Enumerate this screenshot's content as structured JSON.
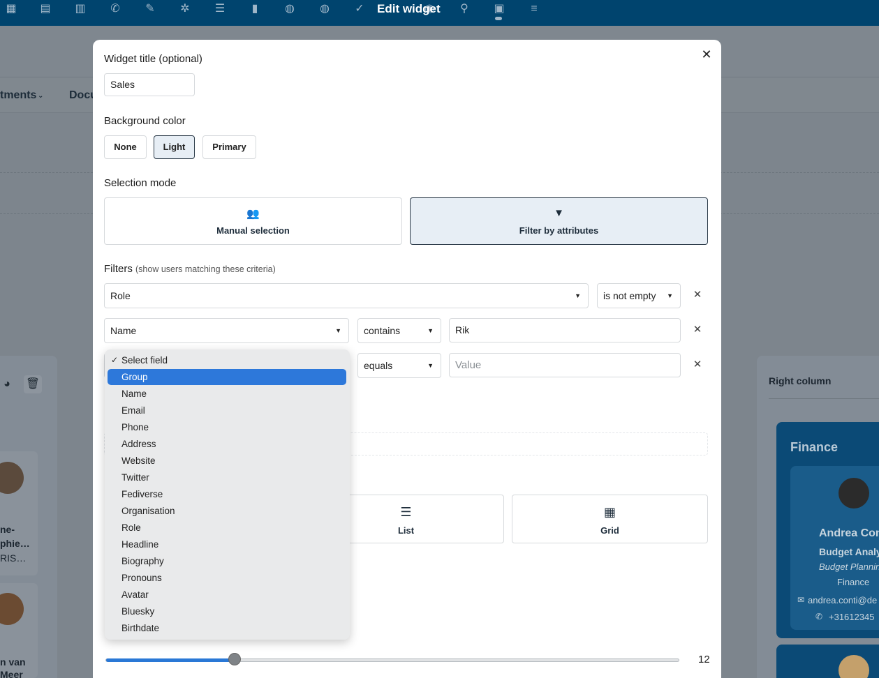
{
  "topbar": {
    "title": "Edit widget",
    "icons": [
      "calendar-icon",
      "document-icon",
      "stack-icon",
      "megaphone-icon",
      "pencil-icon",
      "hub-icon",
      "list-icon",
      "bar-chart-icon",
      "globe-icon",
      "globe-icon",
      "check-icon",
      "group-icon",
      "key-icon",
      "form-icon",
      "align-icon"
    ]
  },
  "background": {
    "nav_item_1": "tments",
    "nav_item_2": "Docu",
    "right_column_title": "Right column",
    "left_card_1_lines": [
      "ne-",
      "phie…",
      "RIS…"
    ],
    "left_card_2_lines": [
      "n van",
      "Meer"
    ],
    "finance_title": "Finance",
    "finance_person": {
      "name": "Andrea Con",
      "title": "Budget Analy",
      "department": "Budget Plannin",
      "group": "Finance",
      "email": "andrea.conti@de",
      "phone": "+31612345"
    }
  },
  "modal": {
    "widget_title_label": "Widget title (optional)",
    "widget_title_value": "Sales",
    "background_color_label": "Background color",
    "bg_options": [
      {
        "label": "None",
        "active": false
      },
      {
        "label": "Light",
        "active": true
      },
      {
        "label": "Primary",
        "active": false
      }
    ],
    "selection_mode_label": "Selection mode",
    "modes": [
      {
        "label": "Manual selection",
        "icon": "users-plus-icon",
        "active": false
      },
      {
        "label": "Filter by attributes",
        "icon": "filter-icon",
        "active": true
      }
    ],
    "filters_label": "Filters",
    "filters_hint": "(show users matching these criteria)",
    "filters": [
      {
        "field": "Role",
        "operator": "is not empty",
        "value": ""
      },
      {
        "field": "Name",
        "operator": "contains",
        "value": "Rik"
      },
      {
        "field": "Select field",
        "operator": "equals",
        "value": "",
        "placeholder": "Value"
      }
    ],
    "layouts": [
      {
        "label": "List",
        "icon": "list-icon"
      },
      {
        "label": "Grid",
        "icon": "grid-icon"
      }
    ],
    "slider": {
      "value": 12,
      "min": 1,
      "max": 50
    }
  },
  "dropdown": {
    "selected": "Select field",
    "highlighted": "Group",
    "options": [
      "Select field",
      "Group",
      "Name",
      "Email",
      "Phone",
      "Address",
      "Website",
      "Twitter",
      "Fediverse",
      "Organisation",
      "Role",
      "Headline",
      "Biography",
      "Pronouns",
      "Avatar",
      "Bluesky",
      "Birthdate"
    ]
  }
}
